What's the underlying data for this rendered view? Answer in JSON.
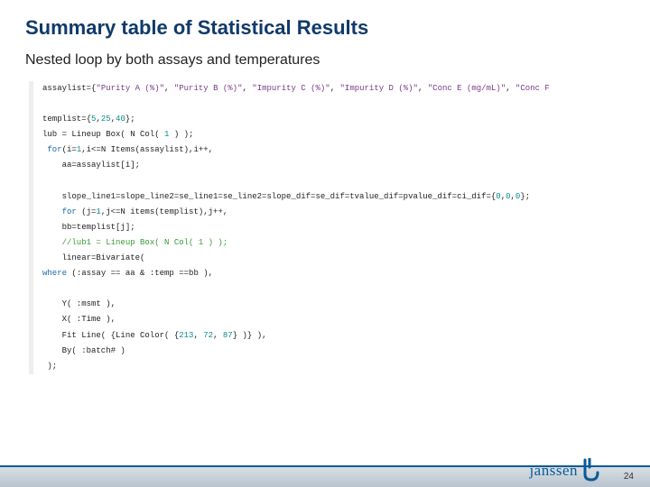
{
  "title": "Summary table of Statistical Results",
  "subtitle": "Nested loop by both assays and temperatures",
  "code": {
    "l1_a": "assaylist={",
    "l1_b": "\"Purity A (%)\"",
    "l1_c": ", ",
    "l1_d": "\"Purity B (%)\"",
    "l1_e": ", ",
    "l1_f": "\"Impurity C (%)\"",
    "l1_g": ", ",
    "l1_h": "\"Impurity D (%)\"",
    "l1_i": ", ",
    "l1_j": "\"Conc E (mg/mL)\"",
    "l1_k": ", ",
    "l1_l": "\"Conc F",
    "l2_a": "templist={",
    "l2_b": "5",
    "l2_c": ",",
    "l2_d": "25",
    "l2_e": ",",
    "l2_f": "40",
    "l2_g": "};",
    "l3_a": "lub = Lineup Box( N Col( ",
    "l3_b": "1",
    "l3_c": " ) );",
    "l4_a": "for",
    "l4_b": "(i=",
    "l4_c": "1",
    "l4_d": ",i<=N Items(assaylist),i++,",
    "l5": "    aa=assaylist[i];",
    "l6_a": "    slope_line1=slope_line2=se_line1=se_line2=slope_dif=se_dif=tvalue_dif=pvalue_dif=ci_dif={",
    "l6_b": "0",
    "l6_c": ",",
    "l6_d": "0",
    "l6_e": ",",
    "l6_f": "0",
    "l6_g": "};",
    "l7_a": "    for",
    "l7_b": " (j=",
    "l7_c": "1",
    "l7_d": ",j<=N items(templist),j++,",
    "l8": "    bb=templist[j];",
    "l9": "    //lub1 = Lineup Box( N Col( 1 ) );",
    "l10": "    linear=Bivariate(",
    "l11_a": "where",
    "l11_b": " (:assay == aa & :temp ==bb ),",
    "l12": "    Y( :msmt ),",
    "l13": "    X( :Time ),",
    "l14_a": "    Fit Line( {Line Color( {",
    "l14_b": "213",
    "l14_c": ", ",
    "l14_d": "72",
    "l14_e": ", ",
    "l14_f": "87",
    "l14_g": "} )} ),",
    "l15": "    By( :batch# )",
    "l16": " );"
  },
  "logo_text": "janssen",
  "page_number": "24"
}
